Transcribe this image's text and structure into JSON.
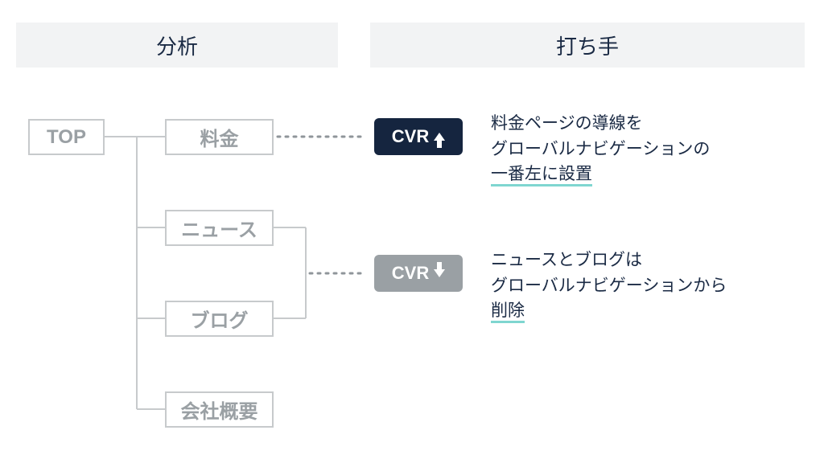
{
  "headers": {
    "left": "分析",
    "right": "打ち手"
  },
  "tree": {
    "root": "TOP",
    "children": [
      "料金",
      "ニュース",
      "ブログ",
      "会社概要"
    ]
  },
  "badges": {
    "up": {
      "label": "CVR",
      "direction": "up"
    },
    "down": {
      "label": "CVR",
      "direction": "down"
    }
  },
  "actions": {
    "a1": {
      "line1": "料金ページの導線を",
      "line2": "グローバルナビゲーションの",
      "line3_emph": "一番左に設置"
    },
    "a2": {
      "line1": "ニュースとブログは",
      "line2": "グローバルナビゲーションから",
      "line3_emph": "削除"
    }
  }
}
